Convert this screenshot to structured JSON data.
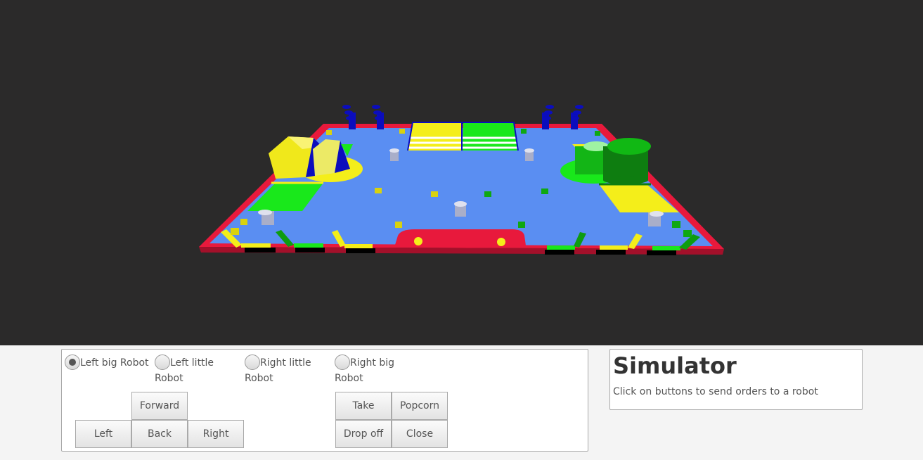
{
  "colors": {
    "background": "#2b2a2a",
    "table_blue": "#5a8ef2",
    "border_red": "#e8193c",
    "yellow": "#f4ee1a",
    "green": "#19e81b",
    "dark_blue": "#0b0dbd"
  },
  "robot_selector": {
    "options": [
      {
        "label": "Left big Robot",
        "checked": true
      },
      {
        "label": "Left little Robot",
        "checked": false
      },
      {
        "label": "Right little Robot",
        "checked": false
      },
      {
        "label": "Right big Robot",
        "checked": false
      }
    ]
  },
  "movement": {
    "forward": "Forward",
    "left": "Left",
    "back": "Back",
    "right": "Right"
  },
  "actions": {
    "take": "Take",
    "popcorn": "Popcorn",
    "drop_off": "Drop off",
    "close": "Close"
  },
  "simulator": {
    "title": "Simulator",
    "description": "Click on buttons to send orders to a robot"
  }
}
